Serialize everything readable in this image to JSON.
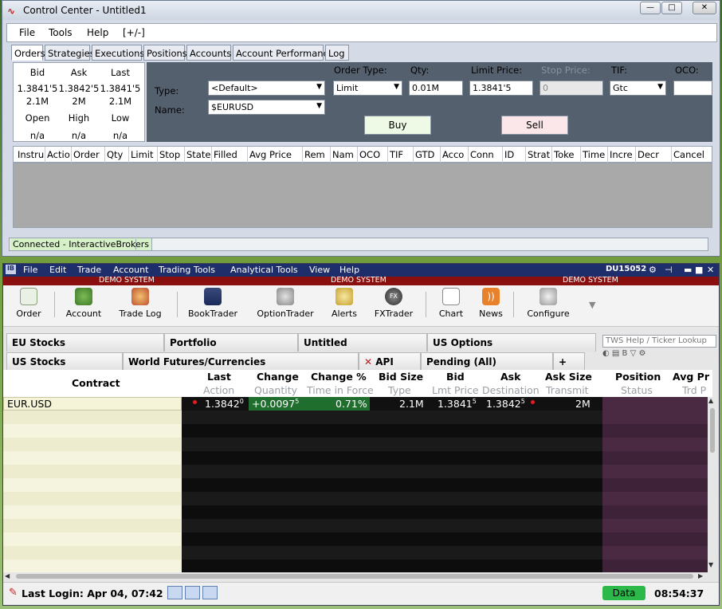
{
  "control_center": {
    "title": "Control Center - Untitled1",
    "menu": [
      "File",
      "Tools",
      "Help",
      "[+/-]"
    ],
    "tabs": [
      "Orders",
      "Strategies",
      "Executions",
      "Positions",
      "Accounts",
      "Account Performance",
      "Log"
    ],
    "quote": {
      "bid_label": "Bid",
      "ask_label": "Ask",
      "last_label": "Last",
      "bid": "1.3841'5",
      "ask": "1.3842'5",
      "last": "1.3841'5",
      "bid_size": "2.1M",
      "ask_size": "2M",
      "last_size": "2.1M",
      "open_label": "Open",
      "high_label": "High",
      "low_label": "Low",
      "open": "n/a",
      "high": "n/a",
      "low": "n/a"
    },
    "order": {
      "type_label": "Type:",
      "type_value": "<Default>",
      "name_label": "Name:",
      "name_value": "$EURUSD",
      "order_type_label": "Order Type:",
      "order_type_value": "Limit",
      "qty_label": "Qty:",
      "qty_value": "0.01M",
      "limit_label": "Limit Price:",
      "limit_value": "1.3841'5",
      "stop_label": "Stop Price:",
      "stop_value": "0",
      "tif_label": "TIF:",
      "tif_value": "Gtc",
      "oco_label": "OCO:",
      "oco_value": "",
      "buy_label": "Buy",
      "sell_label": "Sell"
    },
    "grid_columns": [
      "Instru",
      "Actio",
      "Order",
      "Qty",
      "Limit",
      "Stop",
      "State",
      "Filled",
      "Avg Price",
      "Rem",
      "Nam",
      "OCO",
      "TIF",
      "GTD",
      "Acco",
      "Conn",
      "ID",
      "Strat",
      "Toke",
      "Time",
      "Incre",
      "Decr",
      "Cancel"
    ],
    "status": "Connected - InteractiveBrokers"
  },
  "tws": {
    "menu": [
      "File",
      "Edit",
      "Trade",
      "Account",
      "Trading Tools",
      "Analytical Tools",
      "View",
      "Help"
    ],
    "account_id": "DU15052",
    "demo_label": "DEMO SYSTEM",
    "toolbar": [
      "Order",
      "Account",
      "Trade Log",
      "BookTrader",
      "OptionTrader",
      "Alerts",
      "FXTrader",
      "Chart",
      "News",
      "Configure"
    ],
    "search_placeholder": "TWS Help / Ticker Lookup",
    "tabs_row1": [
      "EU Stocks",
      "Portfolio",
      "Untitled",
      "US Options"
    ],
    "tabs_row2": [
      "US Stocks",
      "World Futures/Currencies",
      "API",
      "Pending (All)",
      "+"
    ],
    "columns": {
      "contract": "Contract",
      "main": [
        "Last",
        "Change",
        "Change %",
        "Bid Size",
        "Bid",
        "Ask",
        "Ask Size",
        "Position",
        "Avg Pr"
      ],
      "sub": [
        "Action",
        "Quantity",
        "Time in Force",
        "Type",
        "Lmt Price",
        "Destination",
        "Transmit",
        "Status",
        "Trd P"
      ]
    },
    "row": {
      "contract": "EUR.USD",
      "last": "1.3842",
      "last_sup": "0",
      "change": "+0.0097",
      "change_sup": "5",
      "change_pct": "0.71%",
      "bid_size": "2.1M",
      "bid": "1.3841",
      "bid_sup": "5",
      "ask": "1.3842",
      "ask_sup": "5",
      "ask_size": "2M"
    },
    "last_login": "Last Login: Apr 04, 07:42",
    "data_label": "Data",
    "clock": "08:54:37"
  }
}
